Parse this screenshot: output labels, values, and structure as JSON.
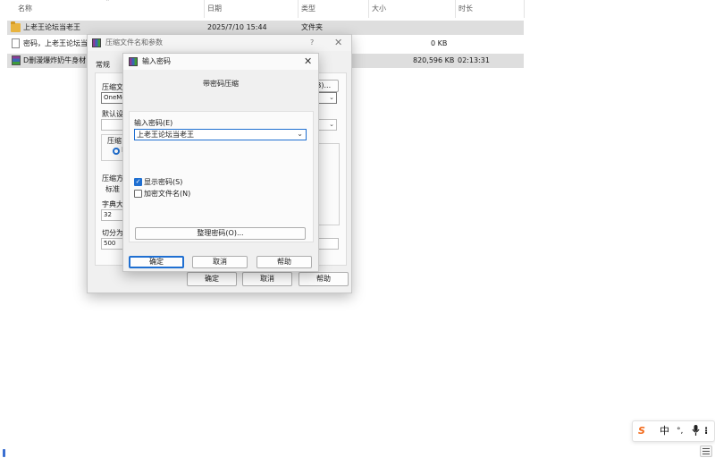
{
  "explorer": {
    "columns": [
      "名称",
      "日期",
      "类型",
      "大小",
      "时长"
    ],
    "files": [
      {
        "name": "上老王论坛当老王",
        "date": "2025/7/10 15:44",
        "type": "文件夹",
        "size": "",
        "duration": "",
        "icon": "folder-icon"
      },
      {
        "name": "密码，上老王论坛当",
        "date": "",
        "type": "",
        "size": "0 KB",
        "duration": "",
        "icon": "text-file-icon"
      },
      {
        "name": "D删漫爆炸奶牛身材",
        "date": "",
        "type": "",
        "size": "820,596 KB",
        "duration": "02:13:31",
        "icon": "archive-file-icon"
      }
    ]
  },
  "back_dialog": {
    "title": "压缩文件名和参数",
    "help_glyph": "?",
    "tab": "常规",
    "archive_name_label": "压缩文",
    "archive_name_value": "OneMo",
    "browse_label": "B)...",
    "default_profile_label": "默认设",
    "format_group_label": "压缩",
    "format_radio_text": "F",
    "method_label": "压缩方",
    "method_value": "标准",
    "dict_label": "字典大",
    "dict_value": "32",
    "split_label": "切分为",
    "split_value": "500",
    "ok": "确定",
    "cancel": "取消",
    "help": "帮助"
  },
  "front_dialog": {
    "title": "输入密码",
    "subtitle": "带密码压缩",
    "enter_label": "输入密码(E)",
    "password_value": "上老王论坛当老王",
    "show_password": "显示密码(S)",
    "show_password_checked": true,
    "encrypt_names": "加密文件名(N)",
    "encrypt_names_checked": false,
    "organize": "整理密码(O)...",
    "ok": "确定",
    "cancel": "取消",
    "help": "帮助"
  },
  "tray": {
    "ime_logo": "S",
    "ime_mode": "中",
    "ime_punct": "°,",
    "mic_icon": "microphone-icon",
    "menu_icon": "menu-icon"
  },
  "colors": {
    "accent": "#1f6fd1",
    "selection": "#dedede",
    "ime_brand": "#f26a1b"
  }
}
